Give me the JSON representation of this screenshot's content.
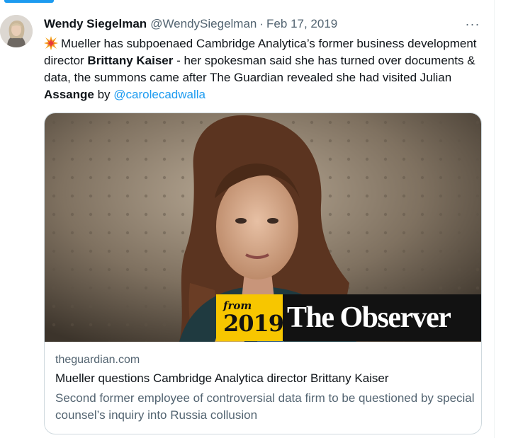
{
  "tweet": {
    "author": {
      "display_name": "Wendy Siegelman",
      "handle": "@WendySiegelman",
      "separator": "·",
      "date": "Feb 17, 2019",
      "avatar_icon": "user-avatar-photo"
    },
    "more_icon": "more-horizontal-icon",
    "more_label": "···",
    "emoji_icon": "collision-emoji-icon",
    "text": {
      "part1": "Mueller has subpoenaed Cambridge Analytica’s former business development director ",
      "bold1": "Brittany Kaiser",
      "part2": " - her spokesman said she has turned over documents & data, the summons came after The Guardian revealed she had visited Julian ",
      "bold2": "Assange",
      "part3": " by ",
      "mention": "@carolecadwalla"
    },
    "card": {
      "image_badge": {
        "from": "from",
        "year": "2019",
        "publication": "The Observer"
      },
      "domain": "theguardian.com",
      "title": "Mueller questions Cambridge Analytica director Brittany Kaiser",
      "description": "Second former employee of controversial data firm to be questioned by special counsel’s inquiry into Russia collusion"
    }
  },
  "colors": {
    "accent": "#1d9bf0",
    "text": "#0f1419",
    "secondary": "#536471",
    "border": "#cfd9de",
    "badge_yellow": "#f7c600",
    "badge_black": "#121212"
  }
}
